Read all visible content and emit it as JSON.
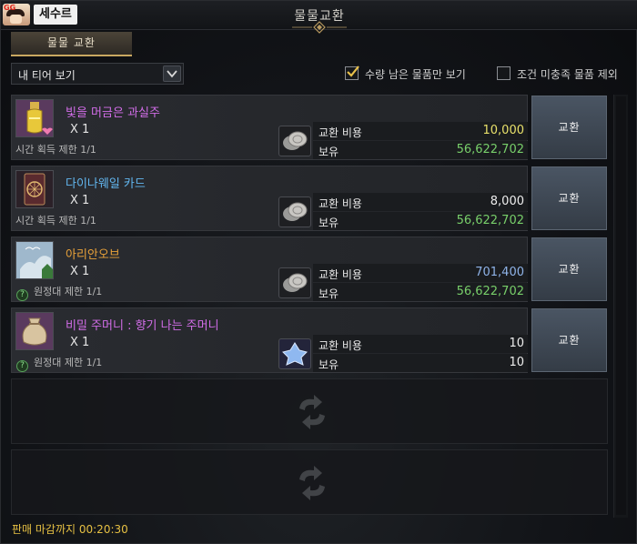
{
  "window": {
    "title": "물물교환"
  },
  "user": {
    "name": "세수르",
    "avatar_badge": "GG"
  },
  "tabs": [
    {
      "label": "물물 교환",
      "active": true
    }
  ],
  "filter": {
    "dropdown_value": "내 티어 보기",
    "checkbox_remaining": {
      "label": "수량 남은 물품만 보기",
      "checked": true
    },
    "checkbox_unmet": {
      "label": "조건 미충족 물품 제외",
      "checked": false
    }
  },
  "items": [
    {
      "name": "빛을 머금은 과실주",
      "name_color": "#d26de8",
      "quantity": "X 1",
      "limit": "시간 획득 제한 1/1",
      "limit_has_help": false,
      "icon": "fruit-wine-icon",
      "cost_label": "교환 비용",
      "cost_value": "10,000",
      "cost_color": "yellow",
      "owned_label": "보유",
      "owned_value": "56,622,702",
      "owned_color": "green",
      "currency_icon": "silver-coin-icon",
      "button": "교환"
    },
    {
      "name": "다이나웨일 카드",
      "name_color": "#62b7f0",
      "quantity": "X 1",
      "limit": "시간 획득 제한 1/1",
      "limit_has_help": false,
      "icon": "card-icon",
      "cost_label": "교환 비용",
      "cost_value": "8,000",
      "cost_color": "white",
      "owned_label": "보유",
      "owned_value": "56,622,702",
      "owned_color": "green",
      "currency_icon": "silver-coin-icon",
      "button": "교환"
    },
    {
      "name": "아리안오브",
      "name_color": "#e8a13a",
      "quantity": "X 1",
      "limit": "원정대 제한 1/1",
      "limit_has_help": true,
      "icon": "orb-icon",
      "cost_label": "교환 비용",
      "cost_value": "701,400",
      "cost_color": "blue",
      "owned_label": "보유",
      "owned_value": "56,622,702",
      "owned_color": "green",
      "currency_icon": "silver-coin-icon",
      "button": "교환"
    },
    {
      "name": "비밀 주머니 : 향기 나는 주머니",
      "name_color": "#d26de8",
      "quantity": "X 1",
      "limit": "원정대 제한 1/1",
      "limit_has_help": true,
      "icon": "pouch-icon",
      "cost_label": "교환 비용",
      "cost_value": "10",
      "cost_color": "white",
      "owned_label": "보유",
      "owned_value": "10",
      "owned_color": "white",
      "currency_icon": "crystal-flower-icon",
      "button": "교환"
    }
  ],
  "footer": {
    "timer": "판매 마감까지 00:20:30"
  }
}
